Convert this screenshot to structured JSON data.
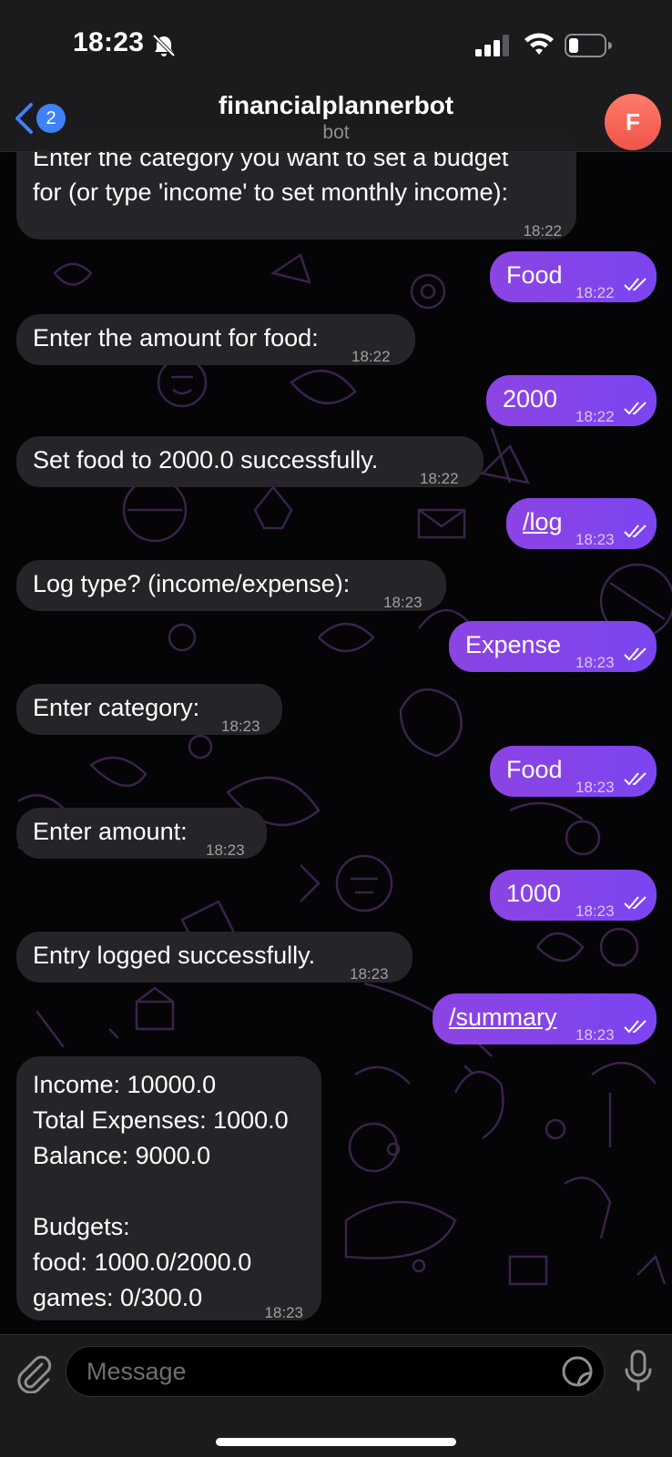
{
  "status_bar": {
    "time": "18:23",
    "icons": [
      "bell-slash-icon",
      "cellular-signal-icon",
      "wifi-icon",
      "battery-icon"
    ]
  },
  "header": {
    "back_badge": "2",
    "title": "financialplannerbot",
    "subtitle": "bot",
    "avatar_letter": "F",
    "avatar_color": "#f0544a"
  },
  "messages": [
    {
      "dir": "in",
      "lines": [
        "Enter the category you want to set a budget",
        "for (or type 'income' to set monthly income):"
      ],
      "time": "18:22"
    },
    {
      "dir": "out",
      "text": "Food",
      "time": "18:22"
    },
    {
      "dir": "in",
      "text": "Enter the amount for food:",
      "time": "18:22"
    },
    {
      "dir": "out",
      "text": "2000",
      "time": "18:22"
    },
    {
      "dir": "in",
      "text": "Set food to 2000.0 successfully.",
      "time": "18:22"
    },
    {
      "dir": "out",
      "text": "/log",
      "time": "18:23"
    },
    {
      "dir": "in",
      "text": "Log type? (income/expense):",
      "time": "18:23"
    },
    {
      "dir": "out",
      "text": "Expense",
      "time": "18:23"
    },
    {
      "dir": "in",
      "text": "Enter category:",
      "time": "18:23"
    },
    {
      "dir": "out",
      "text": "Food",
      "time": "18:23"
    },
    {
      "dir": "in",
      "text": "Enter amount:",
      "time": "18:23"
    },
    {
      "dir": "out",
      "text": "1000",
      "time": "18:23"
    },
    {
      "dir": "in",
      "text": "Entry logged successfully.",
      "time": "18:23"
    },
    {
      "dir": "out",
      "text": "/summary",
      "time": "18:23"
    },
    {
      "dir": "in",
      "lines": [
        "Income: 10000.0",
        "Total Expenses: 1000.0",
        "Balance: 9000.0",
        "",
        "Budgets:",
        "food: 1000.0/2000.0",
        "games: 0/300.0"
      ],
      "time": "18:23"
    }
  ],
  "input": {
    "placeholder": "Message"
  },
  "colors": {
    "outgoing_bubble": "#8c44e3",
    "incoming_bubble": "#262428",
    "accent": "#3e82f7"
  }
}
